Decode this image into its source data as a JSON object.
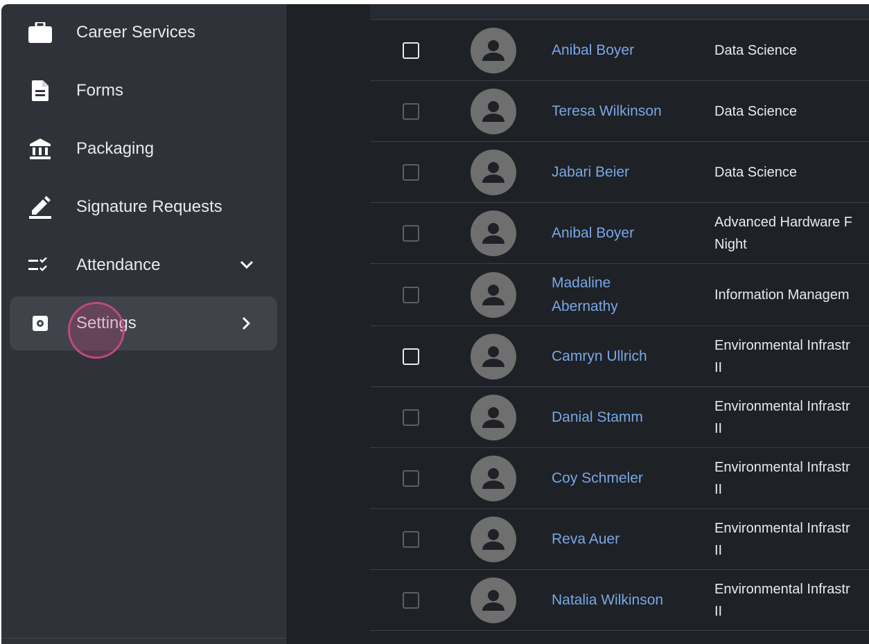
{
  "sidebar": {
    "items": [
      {
        "label": "Career Services",
        "icon": "briefcase-icon"
      },
      {
        "label": "Forms",
        "icon": "document-icon"
      },
      {
        "label": "Packaging",
        "icon": "bank-icon"
      },
      {
        "label": "Signature Requests",
        "icon": "pen-icon"
      },
      {
        "label": "Attendance",
        "icon": "checklist-icon",
        "chevron": "chevron-down-icon"
      },
      {
        "label": "Settings",
        "icon": "gear-icon",
        "chevron": "chevron-right-icon",
        "active": true
      }
    ]
  },
  "table": {
    "rows": [
      {
        "name": "Anibal Boyer",
        "program": "Data Science",
        "checkbox_bright": true
      },
      {
        "name": "Teresa Wilkinson",
        "program": "Data Science"
      },
      {
        "name": "Jabari Beier",
        "program": "Data Science"
      },
      {
        "name": "Anibal Boyer",
        "program": "Advanced Hardware F\nNight"
      },
      {
        "name": "Madaline\nAbernathy",
        "program": "Information Managem"
      },
      {
        "name": "Camryn Ullrich",
        "program": "Environmental Infrastr\nII",
        "checkbox_bright": true
      },
      {
        "name": "Danial Stamm",
        "program": "Environmental Infrastr\nII"
      },
      {
        "name": "Coy Schmeler",
        "program": "Environmental Infrastr\nII"
      },
      {
        "name": "Reva Auer",
        "program": "Environmental Infrastr\nII"
      },
      {
        "name": "Natalia Wilkinson",
        "program": "Environmental Infrastr\nII"
      }
    ]
  },
  "colors": {
    "sidebar_bg": "#2f3238",
    "main_bg": "#1e2126",
    "link": "#7aa7e6",
    "text": "#e8eaed",
    "click_indicator": "#c2497f"
  }
}
